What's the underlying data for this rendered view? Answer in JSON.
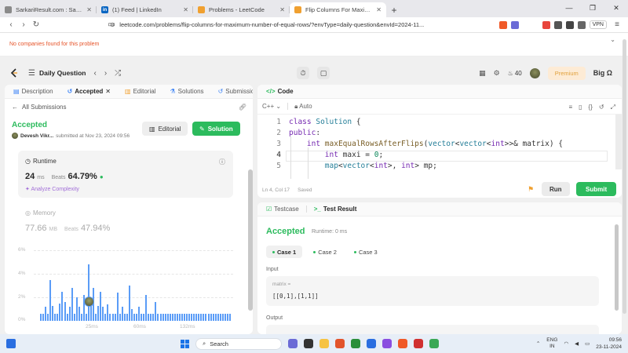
{
  "browser": {
    "tabs": [
      {
        "title": "SarkariResult.com : Sarkari Results...",
        "color": "#7a7a7a",
        "fav": ""
      },
      {
        "title": "(1) Feed | LinkedIn",
        "color": "#0a66c2",
        "fav": "in"
      },
      {
        "title": "Problems - LeetCode",
        "color": "#555",
        "fav": ""
      },
      {
        "title": "Flip Columns For Maximum Nu...",
        "color": "#555",
        "fav": ""
      }
    ],
    "url": "leetcode.com/problems/flip-columns-for-maximum-number-of-equal-rows/?envType=daily-question&envId=2024-11...",
    "vpn_label": "VPN"
  },
  "banner": {
    "text": "No companies found for this problem"
  },
  "lcnav": {
    "daily_label": "Daily Question",
    "streak": "40",
    "premium": "Premium",
    "user": "Big Ω"
  },
  "left": {
    "tabs": [
      "Description",
      "Accepted",
      "Editorial",
      "Solutions",
      "Submissions"
    ],
    "all_submissions": "All Submissions",
    "status": "Accepted",
    "user": "Devesh Vikr...",
    "submitted_at": "submitted at Nov 23, 2024 09:56",
    "editorial_btn": "Editorial",
    "solution_btn": "Solution",
    "runtime": {
      "label": "Runtime",
      "value": "24",
      "unit": "ms",
      "beats_label": "Beats",
      "beats": "64.79%",
      "analyze": "Analyze Complexity"
    },
    "memory": {
      "label": "Memory",
      "value": "77.66",
      "unit": "MB",
      "beats_label": "Beats",
      "beats": "47.94%"
    }
  },
  "chart_data": {
    "type": "bar",
    "ylabel_ticks": [
      "6%",
      "4%",
      "2%",
      "0%"
    ],
    "ylim": [
      0,
      6
    ],
    "x_ticks": [
      "25ms",
      "60ms",
      "132ms"
    ],
    "values": [
      0.6,
      0.6,
      1.2,
      0.6,
      3.5,
      1.3,
      0.6,
      0.6,
      1.5,
      2.5,
      1.6,
      0.6,
      1.2,
      2.8,
      0.6,
      2.0,
      1.2,
      0.6,
      2.2,
      0.6,
      4.8,
      1.3,
      2.8,
      0.6,
      1.3,
      2.5,
      1.2,
      0.6,
      1.4,
      0.6,
      0.6,
      0.6,
      2.4,
      0.6,
      1.2,
      0.6,
      0.6,
      3.0,
      1.0,
      0.6,
      0.6,
      1.2,
      0.6,
      0.6,
      2.2,
      0.6,
      0.6,
      0.6,
      1.6,
      0.6,
      0.6,
      0.6,
      0.6,
      0.6,
      0.6,
      0.6,
      0.6,
      0.6,
      0.6,
      0.6,
      0.6,
      0.6,
      0.6,
      0.6,
      0.6,
      0.6,
      0.6,
      0.6,
      0.6,
      0.6,
      0.6,
      0.6,
      0.6,
      0.6,
      0.6,
      0.6,
      0.6,
      0.6,
      0.6,
      0.6
    ],
    "color": "#5a9cf7"
  },
  "code": {
    "title": "Code",
    "lang": "C++",
    "auto": "Auto",
    "lines": [
      "class Solution {",
      "public:",
      "    int maxEqualRowsAfterFlips(vector<vector<int>>& matrix) {",
      "        int maxi = 0;",
      "        map<vector<int>, int> mp;"
    ],
    "position": "Ln 4, Col 17",
    "saved": "Saved",
    "run": "Run",
    "submit": "Submit"
  },
  "result": {
    "tabs": [
      "Testcase",
      "Test Result"
    ],
    "status": "Accepted",
    "runtime": "Runtime: 0 ms",
    "cases": [
      "Case 1",
      "Case 2",
      "Case 3"
    ],
    "input_label": "Input",
    "var_name": "matrix =",
    "input_value": "[[0,1],[1,1]]",
    "output_label": "Output"
  },
  "taskbar": {
    "search": "Search",
    "lang": "ENG",
    "region": "IN",
    "time": "09:56",
    "date": "23-11-2024"
  }
}
